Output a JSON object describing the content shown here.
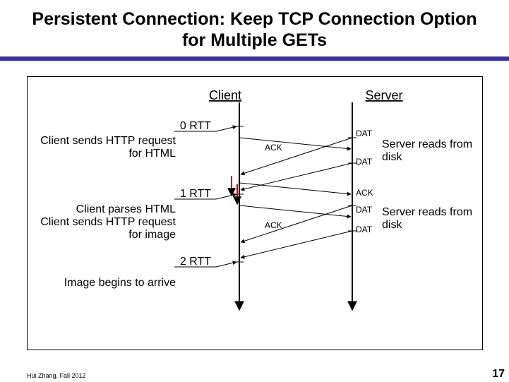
{
  "title": "Persistent Connection: Keep TCP Connection Option for Multiple GETs",
  "headers": {
    "client": "Client",
    "server": "Server"
  },
  "rtt": {
    "r0": "0 RTT",
    "r1": "1 RTT",
    "r2": "2 RTT"
  },
  "client_events": {
    "html_req_l1": "Client sends HTTP request",
    "html_req_l2": "for HTML",
    "parse": "Client parses HTML",
    "img_req_l1": "Client sends HTTP request",
    "img_req_l2": "for image",
    "arrive": "Image begins to arrive"
  },
  "server_events": {
    "read1_l1": "Server reads from",
    "read1_l2": "disk",
    "read2_l1": "Server reads from",
    "read2_l2": "disk"
  },
  "msgs": {
    "ack1": "ACK",
    "dat1a": "DAT",
    "dat1b": "DAT",
    "ack_srv1": "ACK",
    "ack2": "ACK",
    "dat2a": "DAT",
    "dat2b": "DAT"
  },
  "footer": "Hui Zhang, Fall 2012",
  "page": "17"
}
